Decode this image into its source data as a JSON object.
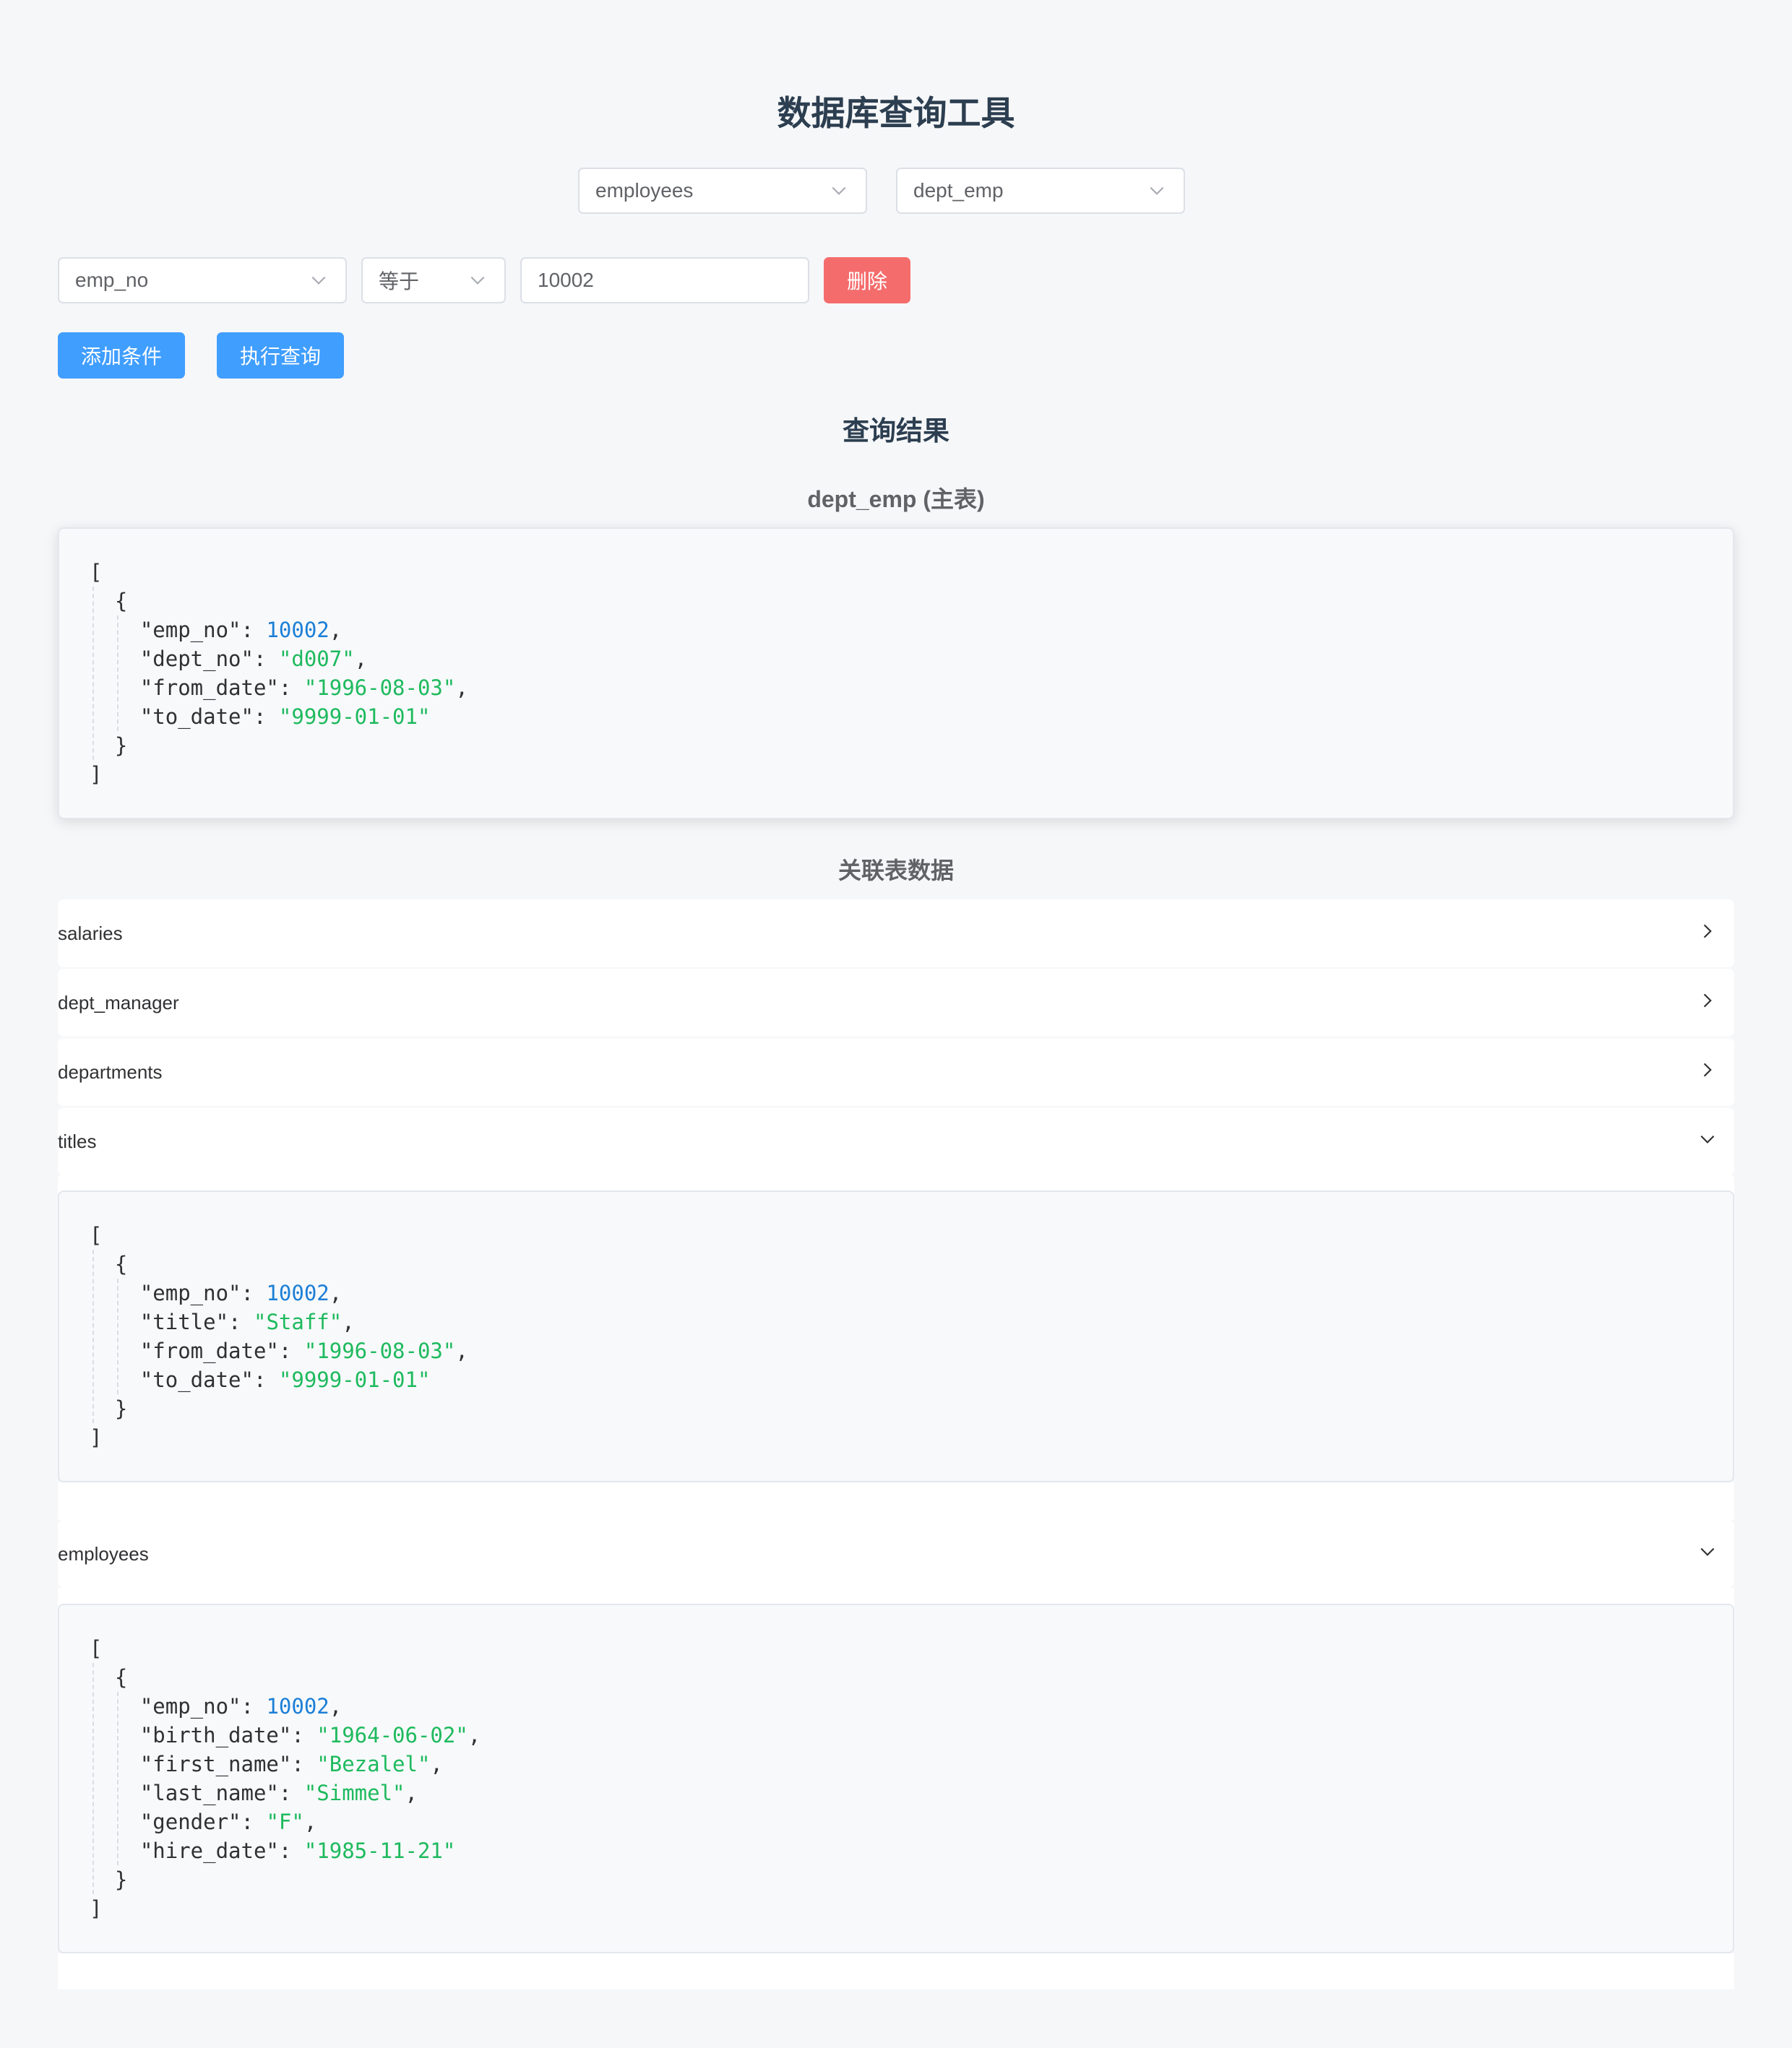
{
  "page_title": "数据库查询工具",
  "database_select": {
    "value": "employees",
    "icon": "chevron-down-icon"
  },
  "table_select": {
    "value": "dept_emp",
    "icon": "chevron-down-icon"
  },
  "condition": {
    "field": "emp_no",
    "operator": "等于",
    "value": "10002",
    "delete_label": "删除"
  },
  "actions": {
    "add_condition": "添加条件",
    "execute_query": "执行查询"
  },
  "results": {
    "title": "查询结果",
    "main_table_title": "dept_emp (主表)",
    "main_json": [
      {
        "emp_no": 10002,
        "dept_no": "d007",
        "from_date": "1996-08-03",
        "to_date": "9999-01-01"
      }
    ],
    "related_title": "关联表数据",
    "related": [
      {
        "name": "salaries",
        "expanded": false
      },
      {
        "name": "dept_manager",
        "expanded": false
      },
      {
        "name": "departments",
        "expanded": false
      },
      {
        "name": "titles",
        "expanded": true,
        "json": [
          {
            "emp_no": 10002,
            "title": "Staff",
            "from_date": "1996-08-03",
            "to_date": "9999-01-01"
          }
        ]
      },
      {
        "name": "employees",
        "expanded": true,
        "json": [
          {
            "emp_no": 10002,
            "birth_date": "1964-06-02",
            "first_name": "Bezalel",
            "last_name": "Simmel",
            "gender": "F",
            "hire_date": "1985-11-21"
          }
        ]
      }
    ]
  },
  "colors": {
    "primary": "#409eff",
    "danger": "#f56c6c",
    "json_number": "#1c7fd6",
    "json_string": "#1eba5e"
  }
}
